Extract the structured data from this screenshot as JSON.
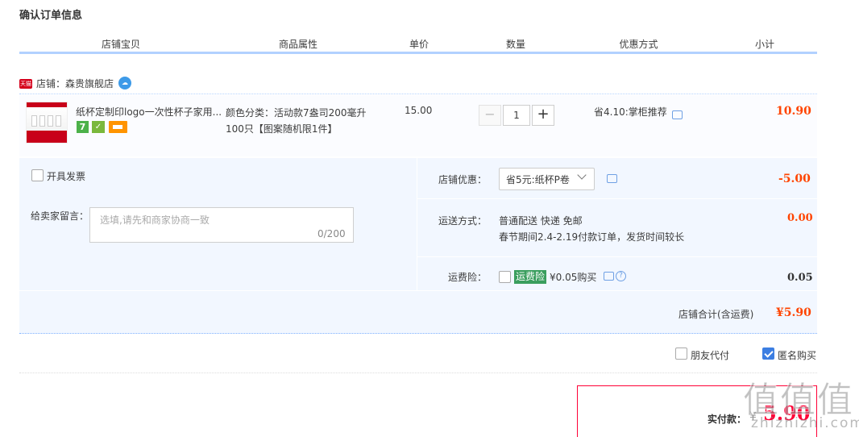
{
  "page_title": "确认订单信息",
  "columns": [
    "店铺宝贝",
    "商品属性",
    "单价",
    "数量",
    "优惠方式",
    "小计"
  ],
  "shop": {
    "tag": "天猫",
    "label": "店铺：森贵旗舰店"
  },
  "item": {
    "name": "纸杯定制印logo一次性杯子家用...",
    "badge7": "7",
    "attr_line1": "颜色分类：活动款7盎司200毫升",
    "attr_line2": "100只【图案随机限1件】",
    "price": "15.00",
    "qty_minus": "−",
    "quantity": "1",
    "qty_plus": "+",
    "promo": "省4.10:掌柜推荐",
    "subtotal": "10.90"
  },
  "invoice_label": "开具发票",
  "memo": {
    "label": "给卖家留言：",
    "placeholder": "选填,请先和商家协商一致",
    "count": "0/200"
  },
  "shop_discount": {
    "label": "店铺优惠：",
    "value": "省5元:纸杯P卷",
    "amount": "-5.00"
  },
  "shipping": {
    "label": "运送方式：",
    "line1": "普通配送 快递 免邮",
    "line2": "春节期间2.4-2.19付款订单，发货时间较长",
    "amount": "0.00"
  },
  "insurance": {
    "label": "运费险：",
    "tag": "运费险",
    "text": "¥0.05购买",
    "amount": "0.05"
  },
  "shop_total": {
    "label": "店铺合计(含运费)",
    "amount": "¥5.90"
  },
  "friend_pay": "朋友代付",
  "anonymous": "匿名购买",
  "pay": {
    "label": "实付款：",
    "yen": "¥",
    "amount": "5.90"
  },
  "watermark": {
    "text": "值值值",
    "sub": "zhizhizhi.com"
  },
  "colors": {
    "red": "#ff4400",
    "blue_line": "#b2d1ff",
    "panel_bg": "#f2f7ff",
    "check": "#3c7ee2"
  }
}
